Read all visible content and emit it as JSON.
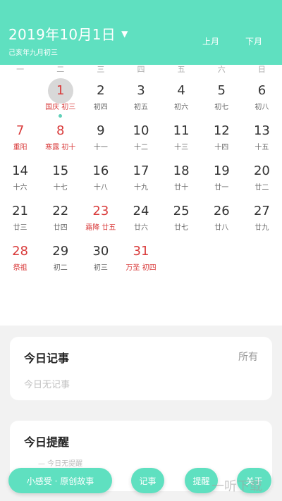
{
  "header": {
    "title": "2019年10月1日",
    "lunar_line": "己亥年九月初三",
    "prev_month": "上月",
    "next_month": "下月"
  },
  "colors": {
    "accent": "#5fe0c0",
    "holiday_red": "#d93b3b"
  },
  "weekdays": [
    "一",
    "二",
    "三",
    "四",
    "五",
    "六",
    "日"
  ],
  "days": [
    {
      "n": "",
      "s": ""
    },
    {
      "n": "1",
      "s": "国庆 初三",
      "red": true,
      "today": true,
      "dot": true
    },
    {
      "n": "2",
      "s": "初四"
    },
    {
      "n": "3",
      "s": "初五"
    },
    {
      "n": "4",
      "s": "初六"
    },
    {
      "n": "5",
      "s": "初七"
    },
    {
      "n": "6",
      "s": "初八"
    },
    {
      "n": "7",
      "s": "重阳",
      "red": true
    },
    {
      "n": "8",
      "s": "寒露 初十",
      "red": true
    },
    {
      "n": "9",
      "s": "十一"
    },
    {
      "n": "10",
      "s": "十二"
    },
    {
      "n": "11",
      "s": "十三"
    },
    {
      "n": "12",
      "s": "十四"
    },
    {
      "n": "13",
      "s": "十五"
    },
    {
      "n": "14",
      "s": "十六"
    },
    {
      "n": "15",
      "s": "十七"
    },
    {
      "n": "16",
      "s": "十八"
    },
    {
      "n": "17",
      "s": "十九"
    },
    {
      "n": "18",
      "s": "廿十"
    },
    {
      "n": "19",
      "s": "廿一"
    },
    {
      "n": "20",
      "s": "廿二"
    },
    {
      "n": "21",
      "s": "廿三"
    },
    {
      "n": "22",
      "s": "廿四"
    },
    {
      "n": "23",
      "s": "霜降 廿五",
      "red": true
    },
    {
      "n": "24",
      "s": "廿六"
    },
    {
      "n": "25",
      "s": "廿七"
    },
    {
      "n": "26",
      "s": "廿八"
    },
    {
      "n": "27",
      "s": "廿九"
    },
    {
      "n": "28",
      "s": "祭祖",
      "red": true
    },
    {
      "n": "29",
      "s": "初二"
    },
    {
      "n": "30",
      "s": "初三"
    },
    {
      "n": "31",
      "s": "万圣 初四",
      "red": true
    }
  ],
  "notes_card": {
    "title": "今日记事",
    "link": "所有",
    "empty": "今日无记事"
  },
  "reminder_card": {
    "title": "今日提醒",
    "hint": "— 今日无提醒"
  },
  "bottom_bar": {
    "story": "小感受 · 原创故事",
    "note": "记事",
    "remind": "提醒",
    "about": "关于"
  },
  "watermark": "一听下载"
}
